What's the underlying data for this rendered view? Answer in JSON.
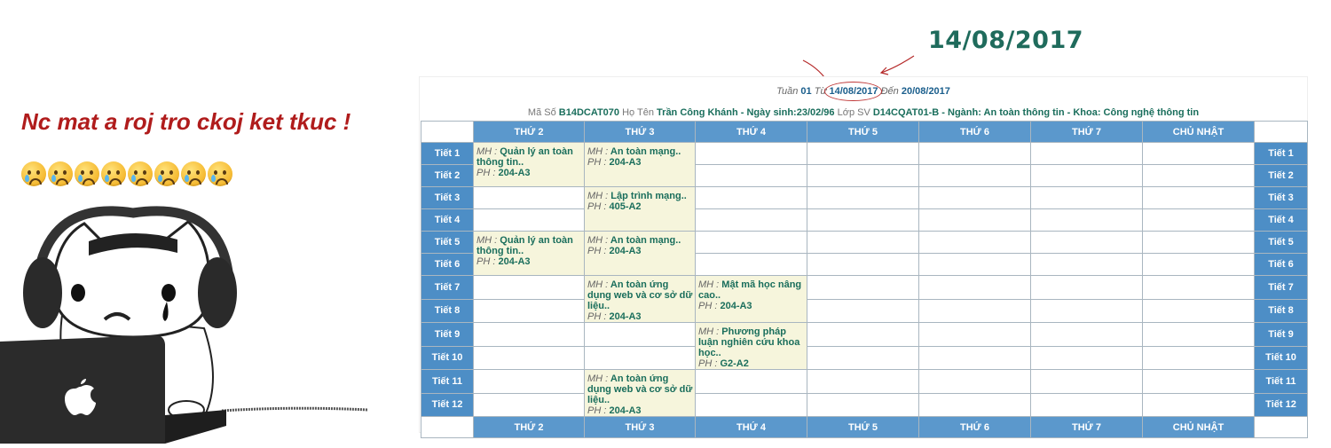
{
  "caption": "Nc mat a roj tro ckoj ket tkuc !",
  "emoji_count": 8,
  "emoji_name": "crying-face",
  "big_date": "14/08/2017",
  "week_line": {
    "tuan_label": "Tuần",
    "tuan_value": "01",
    "tu_label": "Từ",
    "tu_value": "14/08/2017",
    "den_label": "Đến",
    "den_value": "20/08/2017"
  },
  "student": {
    "ma_so_label": "Mã Số",
    "ma_so": "B14DCAT070",
    "ho_ten_label": "Họ Tên",
    "ho_ten": "Trần Công Khánh - Ngày sinh:23/02/96",
    "lop_label": "Lớp SV",
    "lop": "D14CQAT01-B - Ngành: An toàn thông tin - Khoa: Công nghệ thông tin"
  },
  "days": [
    "THỨ 2",
    "THỨ 3",
    "THỨ 4",
    "THỨ 5",
    "THỨ 6",
    "THỨ 7",
    "CHỦ NHẬT"
  ],
  "periods": [
    "Tiết 1",
    "Tiết 2",
    "Tiết 3",
    "Tiết 4",
    "Tiết 5",
    "Tiết 6",
    "Tiết 7",
    "Tiết 8",
    "Tiết 9",
    "Tiết 10",
    "Tiết 11",
    "Tiết 12"
  ],
  "labels": {
    "mh": "MH :",
    "ph": "PH :"
  },
  "classes": [
    {
      "day": 0,
      "start": 0,
      "span": 2,
      "subject": "Quản lý an toàn thông tin..",
      "room": "204-A3"
    },
    {
      "day": 1,
      "start": 0,
      "span": 2,
      "subject": "An toàn mạng..",
      "room": "204-A3"
    },
    {
      "day": 1,
      "start": 2,
      "span": 2,
      "subject": "Lập trình mạng..",
      "room": "405-A2"
    },
    {
      "day": 0,
      "start": 4,
      "span": 2,
      "subject": "Quản lý an toàn thông tin..",
      "room": "204-A3"
    },
    {
      "day": 1,
      "start": 4,
      "span": 2,
      "subject": "An toàn mạng..",
      "room": "204-A3"
    },
    {
      "day": 1,
      "start": 6,
      "span": 2,
      "subject": "An toàn ứng dụng web và cơ sở dữ liệu..",
      "room": "204-A3"
    },
    {
      "day": 2,
      "start": 6,
      "span": 2,
      "subject": "Mật mã học nâng cao..",
      "room": "204-A3"
    },
    {
      "day": 2,
      "start": 8,
      "span": 2,
      "subject": "Phương pháp luận nghiên cứu khoa học..",
      "room": "G2-A2"
    },
    {
      "day": 1,
      "start": 10,
      "span": 2,
      "subject": "An toàn ứng dụng web và cơ sở dữ liệu..",
      "room": "204-A3"
    }
  ],
  "colors": {
    "header_blue": "#5b98cc",
    "period_blue": "#4d8ec6",
    "class_bg": "#f6f5dc",
    "class_text": "#1a6e5c",
    "caption_red": "#b01c1c",
    "date_green": "#1f6b5c"
  }
}
